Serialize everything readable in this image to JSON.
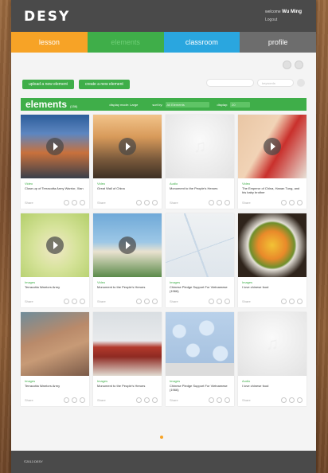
{
  "app": {
    "logo": "DESY"
  },
  "header": {
    "welcome_prefix": "welcome",
    "user_name": "Wu Ming",
    "logout_label": "Logout"
  },
  "nav": [
    {
      "label": "lesson"
    },
    {
      "label": "elements"
    },
    {
      "label": "classroom"
    },
    {
      "label": "profile"
    }
  ],
  "actions": {
    "upload_label": "upload a new element",
    "create_label": "create a new element"
  },
  "search": {
    "field1_placeholder": "",
    "field2_placeholder": "keywords"
  },
  "elements_bar": {
    "title": "elements",
    "count": "(156)",
    "display_mode_label": "display mode: Large",
    "sort_label": "sort by:",
    "sort_value": "All Elements",
    "display_label": "display:",
    "display_value": "20"
  },
  "cards": [
    {
      "type": "Video",
      "title": "Close-up of Terracotta Army Warrior, Xian",
      "share": "Share"
    },
    {
      "type": "Video",
      "title": "Great Wall of China",
      "share": "Share"
    },
    {
      "type": "Audio",
      "title": "Monument to the People's Heroes",
      "share": "Share"
    },
    {
      "type": "Video",
      "title": "The Emperor of China, Hanan Tung, and his baby brother",
      "share": "Share"
    },
    {
      "type": "Images",
      "title": "Terracotta Warriors Army",
      "share": "Share"
    },
    {
      "type": "Video",
      "title": "Monument to the People's Heroes",
      "share": "Share"
    },
    {
      "type": "Images",
      "title": "Chinese Pledge Support For Vietnamese (1966)",
      "share": "Share"
    },
    {
      "type": "Images",
      "title": "I love chinese food",
      "share": "Share"
    },
    {
      "type": "Images",
      "title": "Terracotta Warriors Army",
      "share": "Share"
    },
    {
      "type": "Images",
      "title": "Monument to the People's Heroes",
      "share": "Share"
    },
    {
      "type": "Images",
      "title": "Chinese Pledge Support For Vietnamese (1966)",
      "share": "Share"
    },
    {
      "type": "Audio",
      "title": "I love chinese food",
      "share": "Share"
    }
  ],
  "footer": {
    "text": "©2013 DESY"
  },
  "colors": {
    "lesson": "#f7a326",
    "elements": "#3fae49",
    "classroom": "#2aa6df",
    "profile": "#6d6d6d",
    "topbar": "#4a4a4a"
  }
}
